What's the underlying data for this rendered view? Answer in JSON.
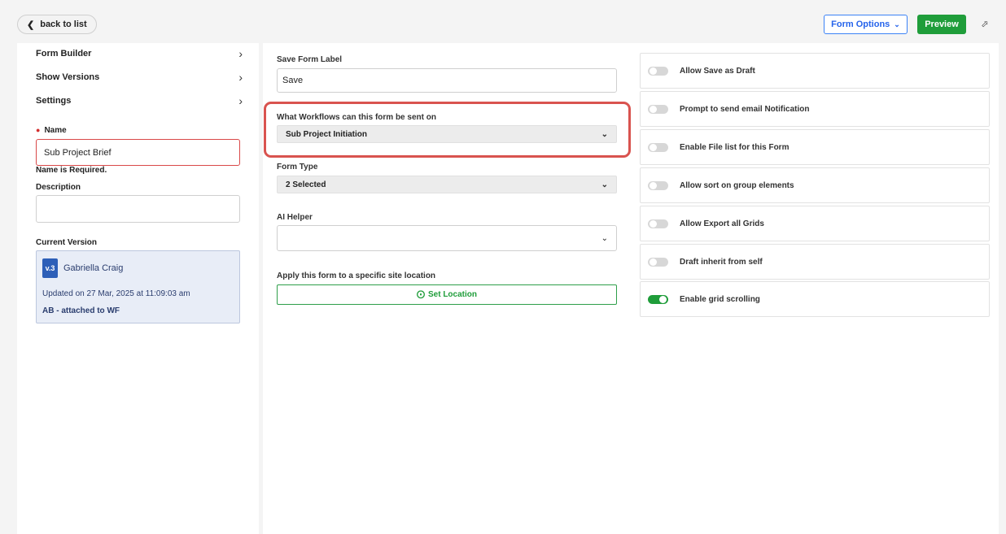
{
  "header": {
    "back_label": "back to list",
    "form_options_label": "Form Options",
    "preview_label": "Preview"
  },
  "sidebar": {
    "nav": [
      {
        "label": "Form Builder"
      },
      {
        "label": "Show Versions"
      },
      {
        "label": "Settings"
      }
    ],
    "name_label": "Name",
    "name_value": "Sub Project Brief",
    "name_error": "Name is Required.",
    "description_label": "Description",
    "description_value": "",
    "current_version_label": "Current Version",
    "version": {
      "badge": "v.3",
      "author": "Gabriella Craig",
      "updated": "Updated on 27 Mar, 2025 at 11:09:03 am",
      "note": "AB - attached to WF"
    }
  },
  "main": {
    "save_label_title": "Save Form Label",
    "save_label_value": "Save",
    "workflows_title": "What Workflows can this form be sent on",
    "workflows_value": "Sub Project Initiation",
    "form_type_title": "Form Type",
    "form_type_value": "2 Selected",
    "ai_helper_title": "AI Helper",
    "ai_helper_value": "",
    "location_title": "Apply this form to a specific site location",
    "set_location_label": "Set Location",
    "highlight_color": "#d9534f"
  },
  "options": [
    {
      "label": "Allow Save as Draft",
      "on": false
    },
    {
      "label": "Prompt to send email Notification",
      "on": false
    },
    {
      "label": "Enable File list for this Form",
      "on": false
    },
    {
      "label": "Allow sort on group elements",
      "on": false
    },
    {
      "label": "Allow Export all Grids",
      "on": false
    },
    {
      "label": "Draft inherit from self",
      "on": false
    },
    {
      "label": "Enable grid scrolling",
      "on": true
    }
  ],
  "colors": {
    "accent_green": "#1f9d3a",
    "accent_blue": "#2563eb",
    "version_card_bg": "#e8edf7"
  },
  "icons": {
    "back": "chevron-left-icon",
    "form_options_caret": "chevron-down-icon",
    "expand": "expand-icon",
    "nav_arrow": "chevron-right-icon",
    "select_caret": "chevron-down-icon",
    "set_location": "target-icon"
  }
}
